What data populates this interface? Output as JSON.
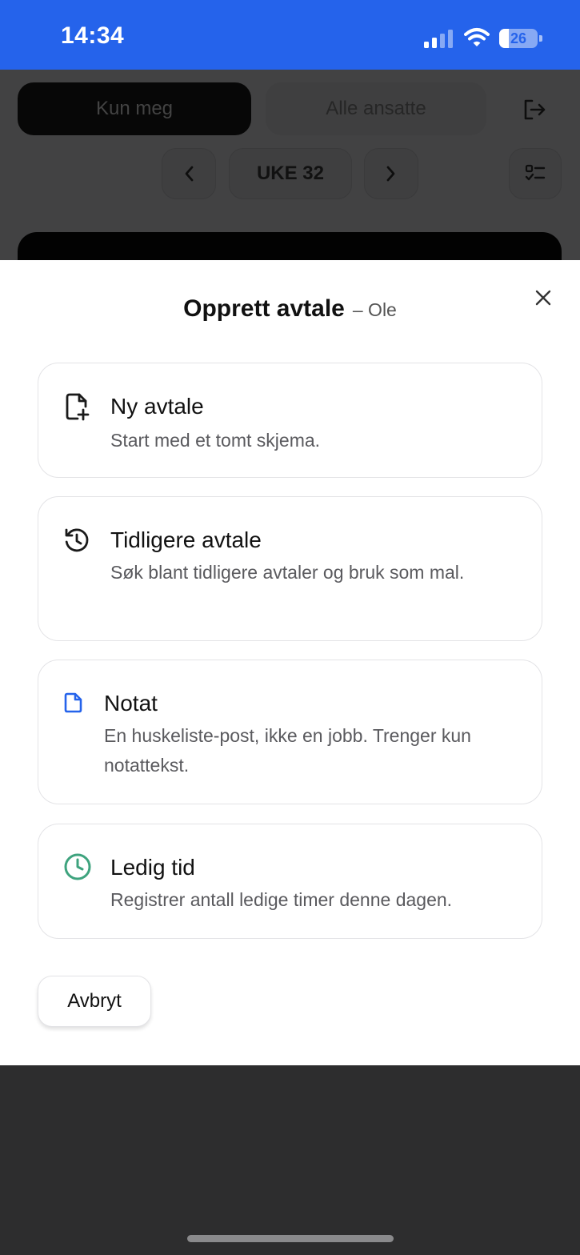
{
  "status_bar": {
    "time": "14:34",
    "battery_level": "26",
    "battery_fraction": 0.26,
    "icons": [
      "signal-icon",
      "wifi-icon",
      "battery-icon"
    ]
  },
  "background": {
    "segment_active": "Kun meg",
    "segment_inactive": "Alle ansatte",
    "week_label": "UKE 32",
    "icons": [
      "logout-icon",
      "chevron-left-icon",
      "chevron-right-icon",
      "checklist-icon"
    ]
  },
  "modal": {
    "title": "Opprett avtale",
    "subtitle": "– Ole",
    "options": [
      {
        "icon": "file-plus-icon",
        "title": "Ny avtale",
        "description": "Start med et tomt skjema."
      },
      {
        "icon": "history-icon",
        "title": "Tidligere avtale",
        "description": "Søk blant tidligere avtaler og bruk som mal."
      },
      {
        "icon": "note-icon",
        "title": "Notat",
        "description": "En huskeliste-post, ikke en jobb. Trenger kun notattekst."
      },
      {
        "icon": "clock-icon",
        "title": "Ledig tid",
        "description": "Registrer antall ledige timer denne dagen."
      }
    ],
    "cancel_label": "Avbryt"
  },
  "colors": {
    "status_bar": "#2563eb",
    "note_icon": "#2563eb",
    "clock_icon": "#3ea37e",
    "overlay": "#2d2d2e"
  }
}
